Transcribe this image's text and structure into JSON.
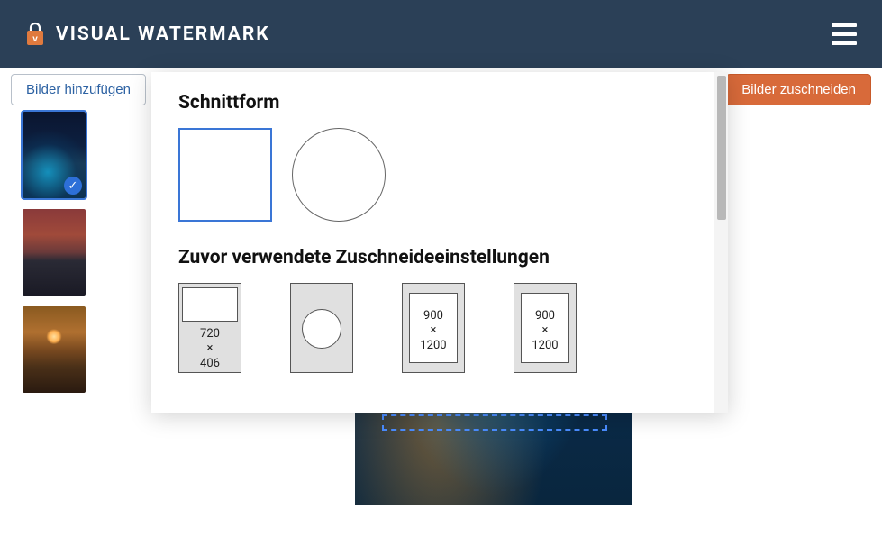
{
  "header": {
    "title": "VISUAL WATERMARK"
  },
  "toolbar": {
    "add_images": "Bilder hinzufügen",
    "crop_images": "Bilder zuschneiden"
  },
  "thumbnails": [
    {
      "name": "city-night",
      "selected": true
    },
    {
      "name": "city-sunset",
      "selected": false
    },
    {
      "name": "sea-sunset",
      "selected": false
    }
  ],
  "panel": {
    "shape_heading": "Schnittform",
    "shapes": [
      "rectangle",
      "circle"
    ],
    "selected_shape": "rectangle",
    "presets_heading": "Zuvor verwendete Zuschneideeinstellungen",
    "presets": [
      {
        "kind": "rect",
        "width": "720",
        "height": "406"
      },
      {
        "kind": "circle"
      },
      {
        "kind": "rect",
        "width": "900",
        "height": "1200"
      },
      {
        "kind": "rect",
        "width": "900",
        "height": "1200"
      }
    ]
  }
}
